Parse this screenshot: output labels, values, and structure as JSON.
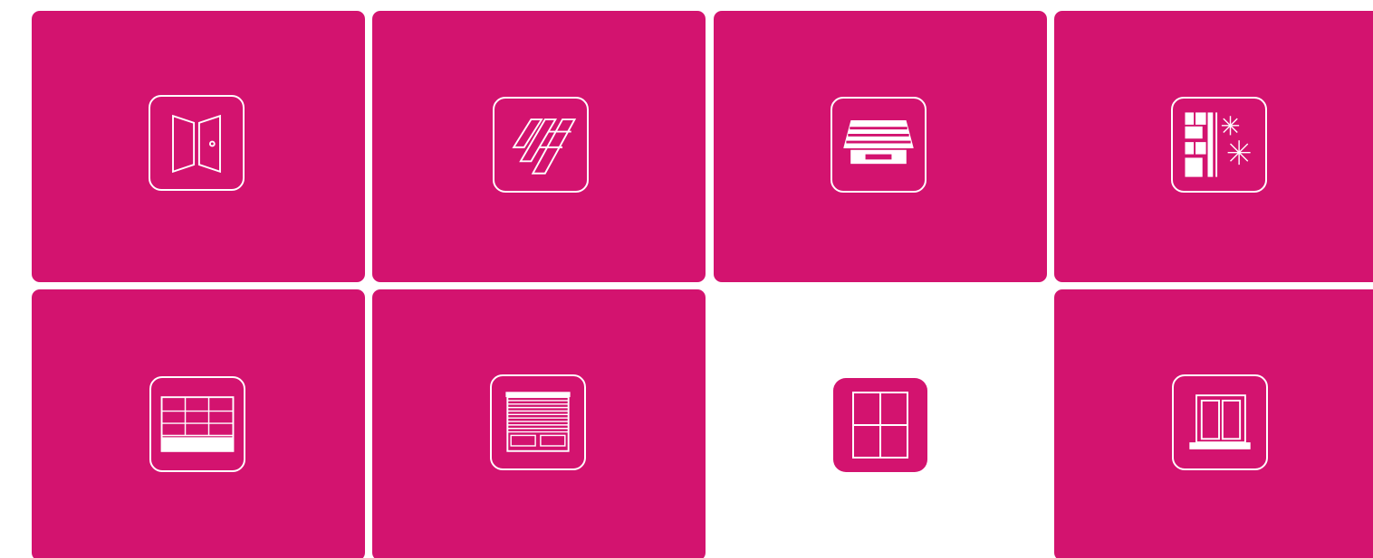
{
  "colors": {
    "tile": "#d3136f",
    "icon": "#ffffff",
    "background": "#ffffff"
  },
  "tiles": [
    {
      "icon": "doors-icon",
      "selected": false
    },
    {
      "icon": "flooring-icon",
      "selected": false
    },
    {
      "icon": "awning-icon",
      "selected": false
    },
    {
      "icon": "insulation-icon",
      "selected": false
    },
    {
      "icon": "garage-door-icon",
      "selected": false
    },
    {
      "icon": "roller-shutter-icon",
      "selected": false
    },
    {
      "icon": "window-icon",
      "selected": true
    },
    {
      "icon": "double-window-icon",
      "selected": false
    }
  ]
}
